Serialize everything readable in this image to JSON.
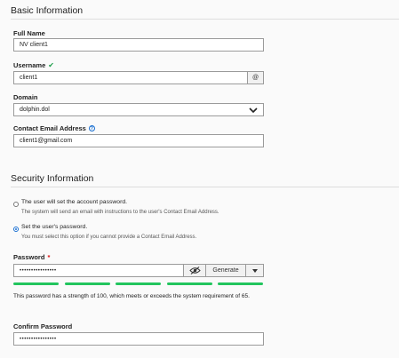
{
  "basic": {
    "title": "Basic Information",
    "full_name_label": "Full Name",
    "full_name_value": "NV client1",
    "username_label": "Username",
    "username_check": "✔",
    "username_value": "client1",
    "username_addon": "@",
    "domain_label": "Domain",
    "domain_value": "dolphin.dol",
    "email_label": "Contact Email Address",
    "email_info": "?",
    "email_value": "client1@gmail.com"
  },
  "security": {
    "title": "Security Information",
    "option1_label": "The user will set the account password.",
    "option1_help": "The system will send an email with instructions to the user's Contact Email Address.",
    "option2_label": "Set the user's password.",
    "option2_help": "You must select this option if you cannot provide a Contact Email Address.",
    "selected_option": 2,
    "password_label": "Password",
    "password_required": "*",
    "password_value": "••••••••••••••••",
    "generate_label": "Generate",
    "strength_segments": 5,
    "strength_note": "This password has a strength of 100, which meets or exceeds the system requirement of 65.",
    "confirm_label": "Confirm Password",
    "confirm_value": "••••••••••••••••"
  },
  "colors": {
    "accent": "#1a6fd1",
    "check": "#1e9e4a",
    "strength": "#22c55e",
    "required": "#dd1111"
  }
}
